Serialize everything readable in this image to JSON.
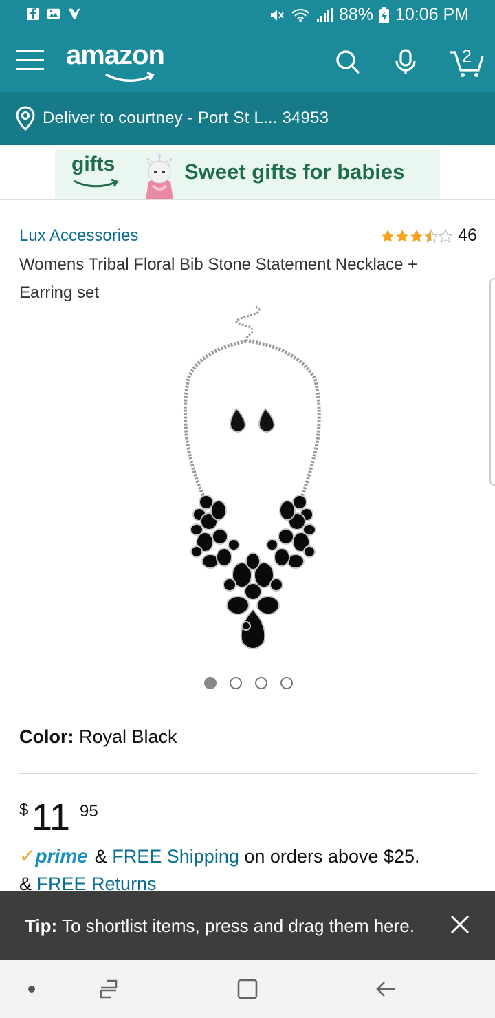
{
  "status_bar": {
    "icons_left": [
      "facebook-icon",
      "gallery-icon",
      "messenger-icon"
    ],
    "icons_right": [
      "mute-icon",
      "wifi-icon",
      "signal-icon"
    ],
    "battery": "88%",
    "time": "10:06 PM"
  },
  "header": {
    "brand": "amazon",
    "cart_count": "2",
    "color": "#1b8a9b"
  },
  "deliver": {
    "text": "Deliver to courtney - Port St L... 34953"
  },
  "banner": {
    "logo": "gifts",
    "tagline": "Sweet gifts for babies"
  },
  "product": {
    "brand": "Lux Accessories",
    "rating": 3.5,
    "rating_count": "46",
    "title": "Womens Tribal Floral Bib Stone Statement Necklace + Earring set",
    "image_count": 4,
    "active_image": 1,
    "color_label": "Color:",
    "color_value": "Royal Black",
    "price_currency": "$",
    "price_whole": "11",
    "price_fraction": "95",
    "prime_check": "✓",
    "prime_word": "prime",
    "shipping_prefix": "&",
    "shipping_link": "FREE Shipping",
    "shipping_suffix": "on orders above $25.",
    "returns_prefix": "&",
    "returns_link": "FREE Returns"
  },
  "tip": {
    "label": "Tip:",
    "text": "To shortlist items, press and drag them here."
  },
  "navbar": {
    "buttons": [
      "dot-icon",
      "recent-apps-icon",
      "home-icon",
      "back-icon"
    ]
  }
}
